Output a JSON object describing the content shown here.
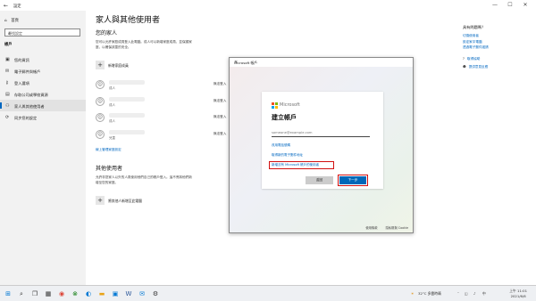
{
  "window": {
    "title": "設定",
    "back_glyph": "←",
    "min": "—",
    "max": "☐",
    "close": "✕"
  },
  "sidebar": {
    "home": "首頁",
    "search_placeholder": "尋找設定",
    "section": "帳戶",
    "items": [
      {
        "label": "您的資訊",
        "icon": "person-card-icon"
      },
      {
        "label": "電子郵件與帳戶",
        "icon": "mail-icon"
      },
      {
        "label": "登入選項",
        "icon": "key-icon"
      },
      {
        "label": "存取公司或學校資源",
        "icon": "briefcase-icon"
      },
      {
        "label": "家人與其他使用者",
        "icon": "people-icon",
        "active": true
      },
      {
        "label": "同步您的設定",
        "icon": "sync-icon"
      }
    ]
  },
  "main": {
    "title": "家人與其他使用者",
    "family_heading": "您的家人",
    "family_desc": "您可以允許家庭成員登入此電腦。成人可以新增家庭成員、並保護家庭，以確保孩童的安全。",
    "add_family": "新增家庭成員",
    "members": [
      {
        "role": "成人",
        "status": "無法登入"
      },
      {
        "role": "成人",
        "status": "無法登入"
      },
      {
        "role": "成人",
        "status": "無法登入"
      },
      {
        "role": "兒童",
        "status": "無法登入"
      }
    ],
    "manage_link": "線上管理家庭設定",
    "other_heading": "其他使用者",
    "other_desc": "允許非您家人以外的人員使用他們自己的帳戶登入。這不會將他們新增至您的家庭。",
    "add_other": "將其他人新增至此電腦"
  },
  "related": {
    "heading": "具有問題嗎？",
    "links": [
      "切換使用者",
      "設定家中電腦",
      "透過電子郵件邀請"
    ],
    "help": [
      {
        "label": "取得協助",
        "icon": "help-icon"
      },
      {
        "label": "提供意見反應",
        "icon": "feedback-icon"
      }
    ]
  },
  "dialog": {
    "title": "Microsoft 帳戶",
    "close": "✕",
    "brand": "Microsoft",
    "heading": "建立帳戶",
    "email_placeholder": "someone@example.com",
    "phone_link": "改用電話號碼",
    "new_email_link": "取得新的電子郵件地址",
    "no_account_link": "新增沒有 Microsoft 帳戶的使用者",
    "back_button": "返回",
    "next_button": "下一步",
    "footer_terms": "使用條款",
    "footer_privacy": "隱私權與 Cookie",
    "logo_colors": [
      "#f25022",
      "#7fba00",
      "#00a4ef",
      "#ffb900"
    ],
    "highlight_color": "#d21010"
  },
  "taskbar": {
    "icons": [
      "windows-start-icon",
      "search-icon",
      "task-view-icon",
      "widgets-icon",
      "chrome-icon",
      "xbox-icon",
      "edge-icon",
      "file-explorer-icon",
      "store-icon",
      "word-icon",
      "mail-icon",
      "settings-icon"
    ],
    "weather": "32°C 多雲時晴",
    "time": "上午 11:01",
    "date": "2021/6/6"
  }
}
